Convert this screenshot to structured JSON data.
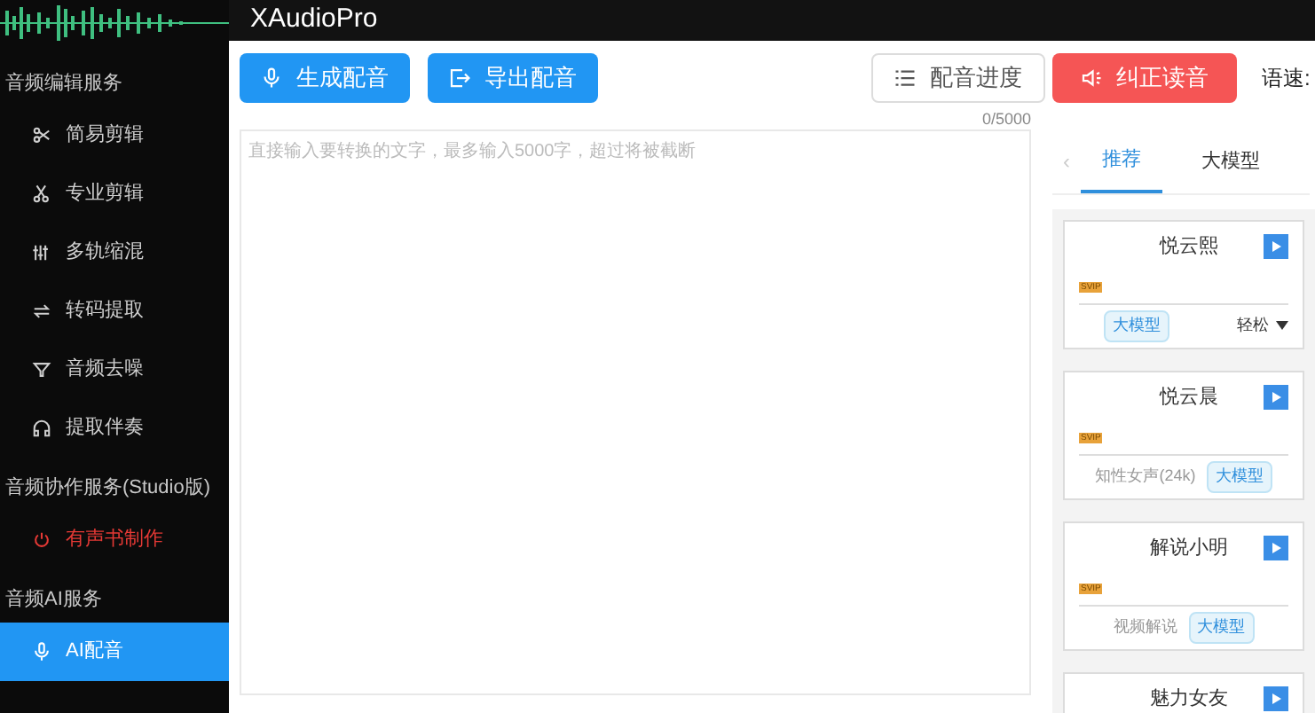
{
  "app_title": "XAudioPro",
  "sidebar": [
    {
      "heading": "音频编辑服务",
      "items": [
        {
          "label": "简易剪辑",
          "selected": false,
          "highlight": false
        },
        {
          "label": "专业剪辑",
          "selected": false,
          "highlight": false
        },
        {
          "label": "多轨缩混",
          "selected": false,
          "highlight": false
        },
        {
          "label": "转码提取",
          "selected": false,
          "highlight": false
        },
        {
          "label": "音频去噪",
          "selected": false,
          "highlight": false
        },
        {
          "label": "提取伴奏",
          "selected": false,
          "highlight": false
        }
      ]
    },
    {
      "heading": "音频协作服务(Studio版)",
      "items": [
        {
          "label": "有声书制作",
          "selected": false,
          "highlight": true
        }
      ]
    },
    {
      "heading": "音频AI服务",
      "items": [
        {
          "label": "AI配音",
          "selected": true,
          "highlight": false
        }
      ]
    }
  ],
  "toolbar": {
    "generate": "生成配音",
    "export": "导出配音",
    "progress": "配音进度",
    "correct": "纠正读音",
    "speed_label": "语速:"
  },
  "editor": {
    "counter": "0/5000",
    "placeholder": "直接输入要转换的文字，最多输入5000字，超过将被截断"
  },
  "voice_tabs_prev": "‹",
  "voice_tabs": [
    {
      "label": "推荐",
      "selected": true
    },
    {
      "label": "大模型",
      "selected": false
    }
  ],
  "voices": [
    {
      "name": "悦云熙",
      "badge": "SVIP",
      "tags": [
        {
          "kind": "tag",
          "text": "大模型"
        },
        {
          "kind": "select",
          "text": "轻松"
        }
      ]
    },
    {
      "name": "悦云晨",
      "badge": "SVIP",
      "tags": [
        {
          "kind": "text",
          "text": "知性女声(24k)"
        },
        {
          "kind": "tag",
          "text": "大模型"
        }
      ]
    },
    {
      "name": "解说小明",
      "badge": "SVIP",
      "tags": [
        {
          "kind": "text",
          "text": "视频解说"
        },
        {
          "kind": "tag",
          "text": "大模型"
        }
      ]
    },
    {
      "name": "魅力女友"
    }
  ]
}
